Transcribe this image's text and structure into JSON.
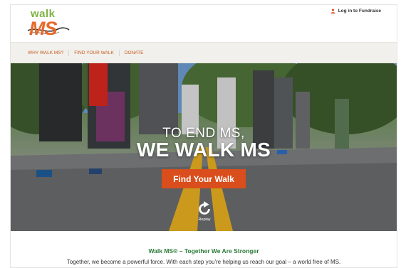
{
  "brand": {
    "logo_word": "walk",
    "logo_mark": "MS",
    "green": "#7cb342",
    "orange": "#e8692b"
  },
  "header": {
    "login_icon": "user-icon",
    "login_label": "Log in to Fundraise"
  },
  "nav": {
    "items": [
      {
        "label": "WHY WALK MS?"
      },
      {
        "label": "FIND YOUR WALK"
      },
      {
        "label": "DONATE"
      }
    ],
    "link_color": "#c85a1e"
  },
  "hero": {
    "line1": "TO END MS,",
    "line2": "WE WALK MS",
    "cta_label": "Find Your Walk",
    "cta_color": "#d94e1c",
    "replay_icon": "replay-icon",
    "replay_label": "Replay"
  },
  "intro": {
    "title": "Walk MS® – Together We Are Stronger",
    "body": "Together, we become a powerful force. With each step you're helping us reach our goal – a world free of MS."
  }
}
